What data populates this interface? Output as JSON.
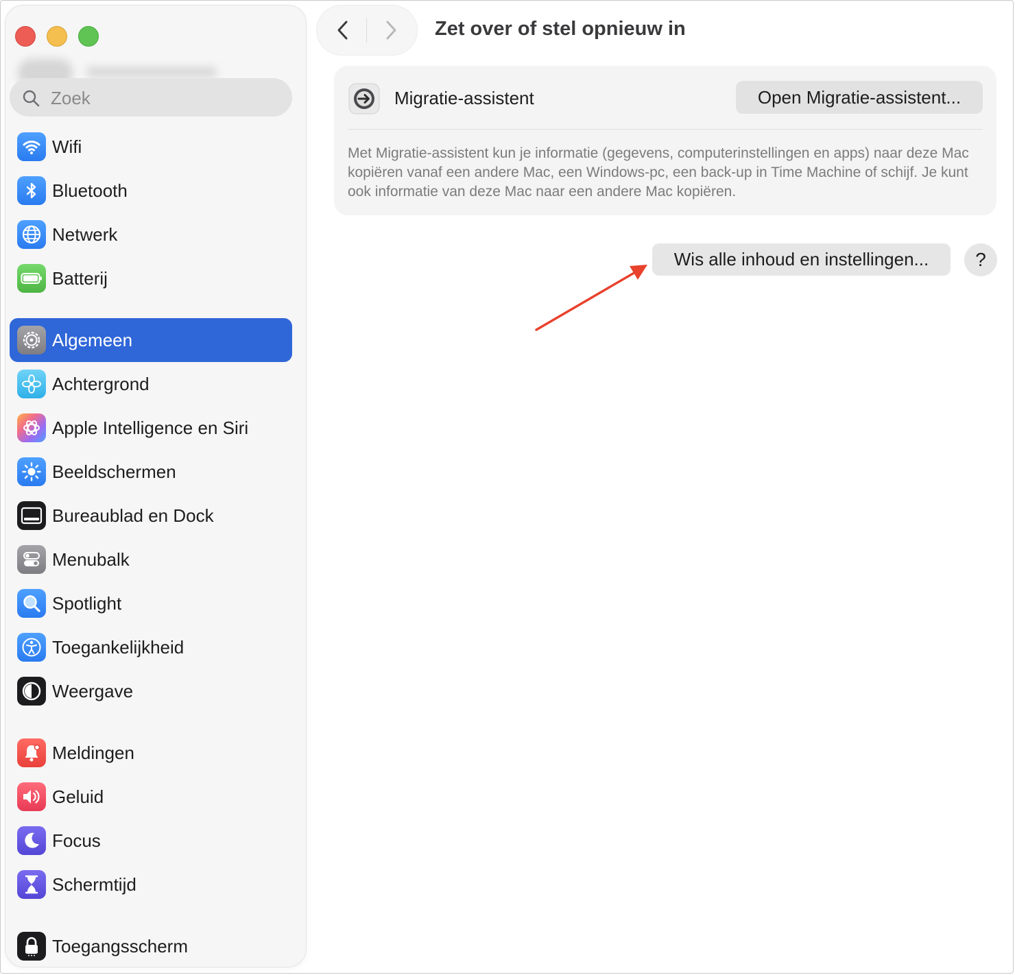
{
  "window": {
    "title": "Zet over of stel opnieuw in"
  },
  "search": {
    "placeholder": "Zoek"
  },
  "sidebar": {
    "items": [
      {
        "label": "Wifi",
        "icon": "wifi-icon",
        "color": "#3a8ef6"
      },
      {
        "label": "Bluetooth",
        "icon": "bluetooth-icon",
        "color": "#3a8ef6"
      },
      {
        "label": "Netwerk",
        "icon": "globe-icon",
        "color": "#3a8ef6"
      },
      {
        "label": "Batterij",
        "icon": "battery-icon",
        "color": "#5fc454"
      },
      {
        "label": "Algemeen",
        "icon": "gear-icon",
        "color": "#8e8e93",
        "active": true
      },
      {
        "label": "Achtergrond",
        "icon": "flower-icon",
        "color": "#4cc4f0"
      },
      {
        "label": "Apple Intelligence en Siri",
        "icon": "apple-intelligence-icon",
        "color": "#f0a050"
      },
      {
        "label": "Beeldschermen",
        "icon": "sun-icon",
        "color": "#3a8ef6"
      },
      {
        "label": "Bureaublad en Dock",
        "icon": "dock-icon",
        "color": "#1c1c1e"
      },
      {
        "label": "Menubalk",
        "icon": "menubar-icon",
        "color": "#8e8e93"
      },
      {
        "label": "Spotlight",
        "icon": "magnifier-icon",
        "color": "#3a8ef6"
      },
      {
        "label": "Toegankelijkheid",
        "icon": "accessibility-icon",
        "color": "#3a8ef6"
      },
      {
        "label": "Weergave",
        "icon": "appearance-icon",
        "color": "#1c1c1e"
      },
      {
        "label": "Meldingen",
        "icon": "bell-icon",
        "color": "#f0504a"
      },
      {
        "label": "Geluid",
        "icon": "speaker-icon",
        "color": "#f0504a"
      },
      {
        "label": "Focus",
        "icon": "moon-icon",
        "color": "#5b5bd6"
      },
      {
        "label": "Schermtijd",
        "icon": "hourglass-icon",
        "color": "#5b5bd6"
      },
      {
        "label": "Toegangsscherm",
        "icon": "lock-icon",
        "color": "#1c1c1e"
      }
    ]
  },
  "migration": {
    "title": "Migratie-assistent",
    "button_label": "Open Migratie-assistent...",
    "description": "Met Migratie-assistent kun je informatie (gegevens, computerinstellingen en apps) naar deze Mac kopiëren vanaf een andere Mac, een Windows-pc, een back-up in Time Machine of schijf. Je kunt ook informatie van deze Mac naar een andere Mac kopiëren."
  },
  "actions": {
    "wipe_label": "Wis alle inhoud en instellingen...",
    "help_label": "?"
  },
  "annotation": {
    "arrow_color": "#e8412c"
  }
}
